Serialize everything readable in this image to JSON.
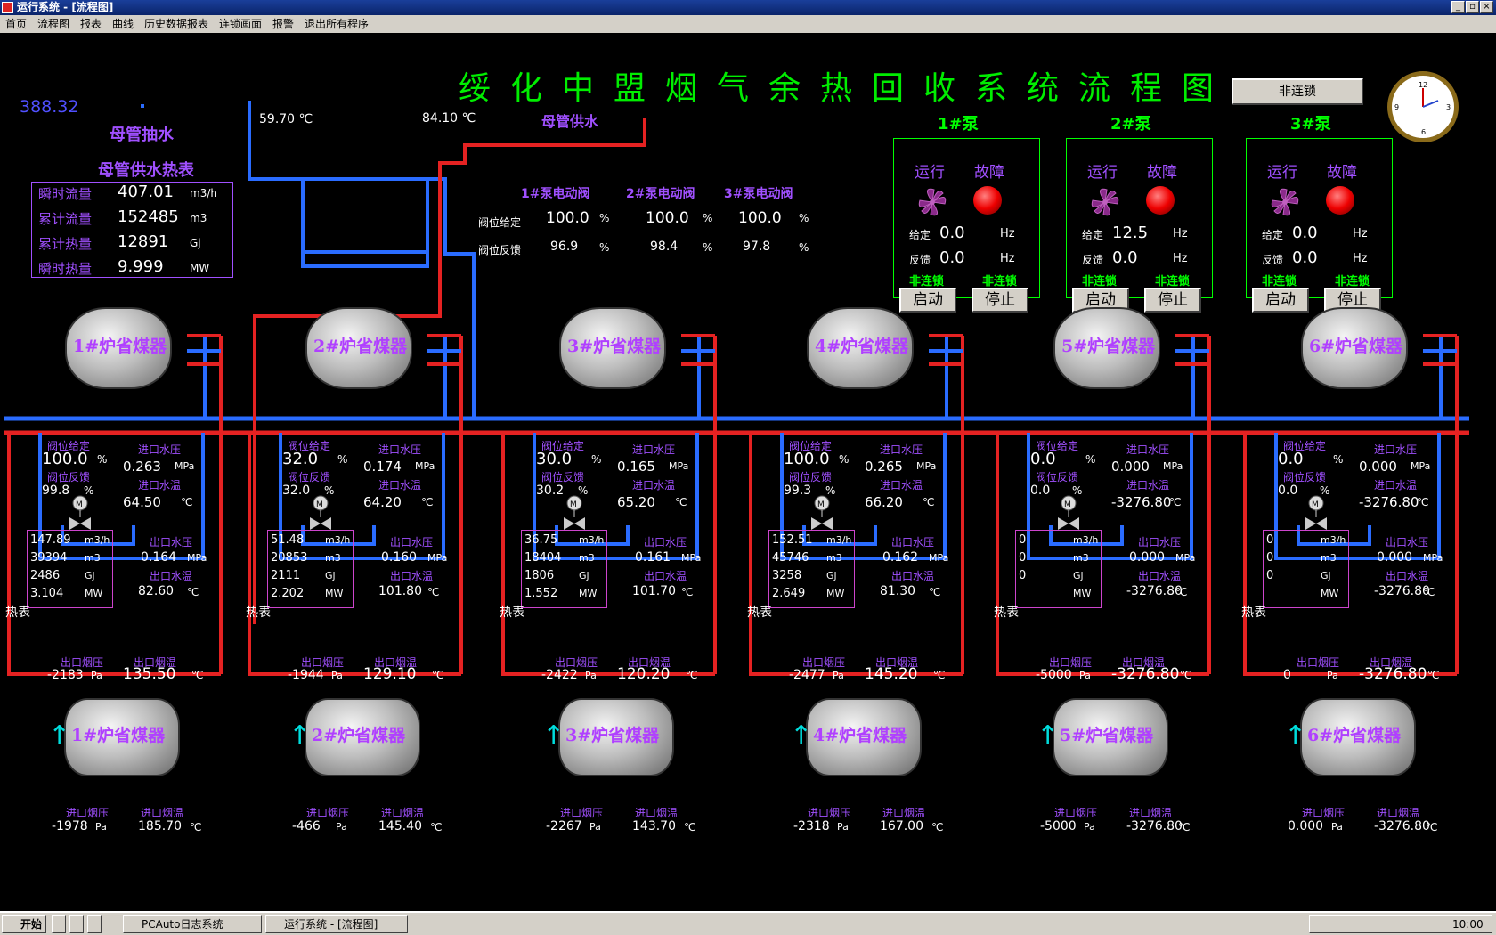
{
  "window": {
    "title": "运行系统 - [流程图]",
    "taskbar_app1": "PCAuto日志系统",
    "taskbar_app2": "运行系统 - [流程图]",
    "start": "开始",
    "time": "10:00"
  },
  "menu": [
    "首页",
    "流程图",
    "报表",
    "曲线",
    "历史数据报表",
    "连锁画面",
    "报警",
    "退出所有程序"
  ],
  "title": "绥化中盟烟气余热回收系统流程图",
  "value_388": "388.32",
  "labels": {
    "mother_pump": "母管抽水",
    "mother_supply": "母管供水",
    "heat_meter": "母管供水热表",
    "temp1": "59.70 ℃",
    "temp2": "84.10 ℃",
    "interlock": "非连锁"
  },
  "heat_meter": {
    "rows": [
      {
        "label": "瞬时流量",
        "value": "407.01",
        "unit": "m3/h"
      },
      {
        "label": "累计流量",
        "value": "152485",
        "unit": "m3"
      },
      {
        "label": "累计热量",
        "value": "12891",
        "unit": "Gj"
      },
      {
        "label": "瞬时热量",
        "value": "9.999",
        "unit": "MW"
      }
    ]
  },
  "valves": {
    "headers": [
      "1#泵电动阀",
      "2#泵电动阀",
      "3#泵电动阀"
    ],
    "set_label": "阀位给定",
    "fb_label": "阀位反馈",
    "set": [
      "100.0",
      "100.0",
      "100.0"
    ],
    "fb": [
      "96.9",
      "98.4",
      "97.8"
    ],
    "unit": "%"
  },
  "pumps": [
    {
      "name": "1#泵",
      "set": "0.0",
      "fb": "0.0"
    },
    {
      "name": "2#泵",
      "set": "12.5",
      "fb": "0.0"
    },
    {
      "name": "3#泵",
      "set": "0.0",
      "fb": "0.0"
    }
  ],
  "pump_text": {
    "run": "运行",
    "fault": "故障",
    "set": "给定",
    "fb": "反馈",
    "hz": "Hz",
    "il": "非连锁",
    "start": "启动",
    "stop": "停止"
  },
  "tank_labels": {
    "vs": "阀位给定",
    "vf": "阀位反馈",
    "ip": "进口水压",
    "it": "进口水温",
    "op": "出口水压",
    "ot": "出口水温",
    "hm": "热表",
    "fop": "出口烟压",
    "fot": "出口烟温",
    "fip": "进口烟压",
    "fit": "进口烟温",
    "pct": "%",
    "mpa": "MPa",
    "c": "℃",
    "pa": "Pa",
    "m3h": "m3/h",
    "m3": "m3",
    "gj": "Gj",
    "mw": "MW"
  },
  "economizers": [
    {
      "name": "1#炉省煤器",
      "vs": "100.0",
      "vf": "99.8",
      "ip": "0.263",
      "it": "64.50",
      "flow": "147.89",
      "vol": "39394",
      "heat": "2486",
      "pwr": "3.104",
      "op": "0.164",
      "ot": "82.60",
      "fop": "-2183",
      "fot": "135.50",
      "fip": "-1978",
      "fit": "185.70"
    },
    {
      "name": "2#炉省煤器",
      "vs": "32.0",
      "vf": "32.0",
      "ip": "0.174",
      "it": "64.20",
      "flow": "51.48",
      "vol": "20853",
      "heat": "2111",
      "pwr": "2.202",
      "op": "0.160",
      "ot": "101.80",
      "fop": "-1944",
      "fot": "129.10",
      "fip": "-466",
      "fit": "145.40"
    },
    {
      "name": "3#炉省煤器",
      "vs": "30.0",
      "vf": "30.2",
      "ip": "0.165",
      "it": "65.20",
      "flow": "36.75",
      "vol": "18404",
      "heat": "1806",
      "pwr": "1.552",
      "op": "0.161",
      "ot": "101.70",
      "fop": "-2422",
      "fot": "120.20",
      "fip": "-2267",
      "fit": "143.70"
    },
    {
      "name": "4#炉省煤器",
      "vs": "100.0",
      "vf": "99.3",
      "ip": "0.265",
      "it": "66.20",
      "flow": "152.51",
      "vol": "45746",
      "heat": "3258",
      "pwr": "2.649",
      "op": "0.162",
      "ot": "81.30",
      "fop": "-2477",
      "fot": "145.20",
      "fip": "-2318",
      "fit": "167.00"
    },
    {
      "name": "5#炉省煤器",
      "vs": "0.0",
      "vf": "0.0",
      "ip": "0.000",
      "it": "-3276.80",
      "flow": "0",
      "vol": "0",
      "heat": "0",
      "pwr": "",
      "op": "0.000",
      "ot": "-3276.80",
      "fop": "-5000",
      "fot": "-3276.80",
      "fip": "-5000",
      "fit": "-3276.80"
    },
    {
      "name": "6#炉省煤器",
      "vs": "0.0",
      "vf": "0.0",
      "ip": "0.000",
      "it": "-3276.80",
      "flow": "0",
      "vol": "0",
      "heat": "0",
      "pwr": "",
      "op": "0.000",
      "ot": "-3276.80",
      "fop": "0",
      "fot": "-3276.80",
      "fip": "0.000",
      "fit": "-3276.80"
    }
  ],
  "colors": {
    "supply_pipe": "#e52222",
    "return_pipe": "#2a6cff",
    "title": "#00ee00",
    "label": "#a050ff"
  }
}
